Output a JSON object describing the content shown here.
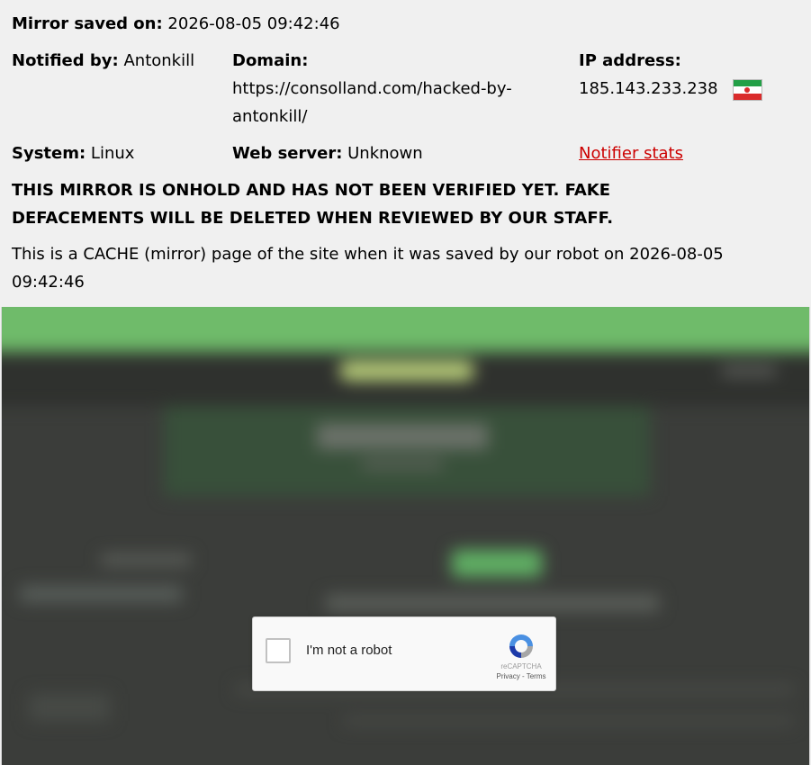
{
  "header": {
    "saved_label": "Mirror saved on:",
    "saved_value": "2026-08-05 09:42:46",
    "notified_label": "Notified by:",
    "notified_value": "Antonkill",
    "domain_label": "Domain:",
    "domain_line1": "https://consolland.com/hacked-by-",
    "domain_line2": "antonkill/",
    "ip_label": "IP address:",
    "ip_value": "185.143.233.238",
    "ip_flag": "iran-flag-icon",
    "system_label": "System:",
    "system_value": "Linux",
    "webserver_label": "Web server:",
    "webserver_value": "Unknown",
    "notifier_stats_link": "Notifier stats"
  },
  "warning": {
    "line1": "THIS MIRROR IS ONHOLD AND HAS NOT BEEN VERIFIED YET. FAKE",
    "line2": "DEFACEMENTS WILL BE DELETED WHEN REVIEWED BY OUR STAFF."
  },
  "cache_note": {
    "line1": "This is a CACHE (mirror) page of the site when it was saved by our robot on 2026-08-05",
    "line2": "09:42:46"
  },
  "captcha": {
    "label": "I'm not a robot",
    "brand": "reCAPTCHA",
    "terms": "Privacy - Terms",
    "logo_icon": "recaptcha-logo-icon"
  },
  "colors": {
    "link": "#cc0000",
    "mirror_bar": "#6fbb6a",
    "mirror_bg": "#3b3d3a"
  }
}
